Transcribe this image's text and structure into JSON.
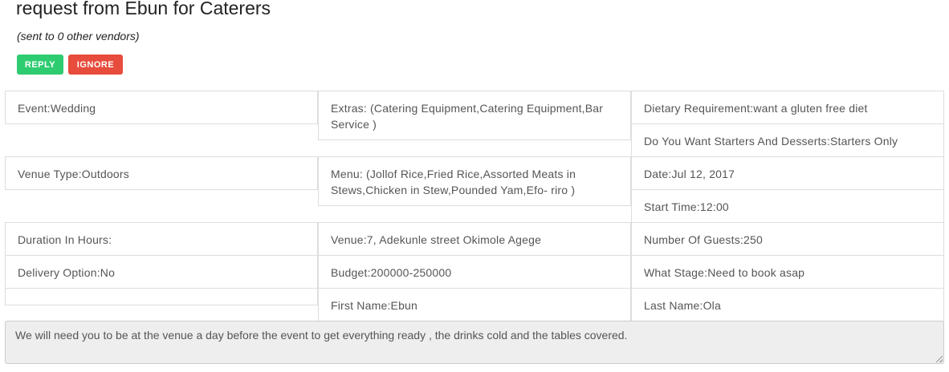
{
  "header": {
    "title": "request from Ebun for Caterers",
    "subtitle": "(sent to 0 other vendors)"
  },
  "actions": {
    "reply_label": "REPLY",
    "ignore_label": "IGNORE"
  },
  "details": {
    "event": "Event:Wedding",
    "venue_type": "Venue Type:Outdoors",
    "duration": "Duration In Hours:",
    "delivery": "Delivery Option:No",
    "extras": "Extras: (Catering Equipment,Catering Equipment,Bar Service )",
    "menu": "Menu: (Jollof Rice,Fried Rice,Assorted Meats in Stews,Chicken in Stew,Pounded Yam,Efo- riro )",
    "venue": "Venue:7, Adekunle street Okimole Agege",
    "budget": "Budget:200000-250000",
    "first_name": "First Name:Ebun",
    "dietary": "Dietary Requirement:want a gluten free diet",
    "starters": "Do You Want Starters And Desserts:Starters Only",
    "date": "Date:Jul 12, 2017",
    "start_time": "Start Time:12:00",
    "guests": "Number Of Guests:250",
    "stage": "What Stage:Need to book asap",
    "last_name": "Last Name:Ola"
  },
  "notes": {
    "text": "We will need you to be at the venue a day before the event to get everything ready , the drinks cold and the tables covered."
  },
  "colors": {
    "reply": "#2ecc71",
    "ignore": "#e74c3c",
    "notes_bg": "#eeeeee"
  }
}
